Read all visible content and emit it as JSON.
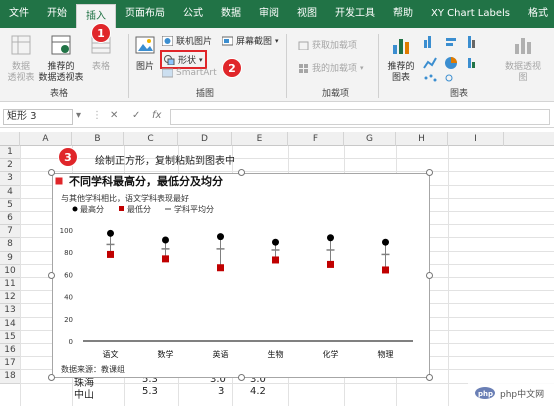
{
  "tabs": [
    "文件",
    "开始",
    "插入",
    "页面布局",
    "公式",
    "数据",
    "审阅",
    "视图",
    "开发工具",
    "帮助",
    "XY Chart Labels",
    "格式"
  ],
  "ribbon": {
    "tables_group": "表格",
    "pivot_label": "数据\n透视表",
    "rec_pivot_label": "推荐的\n数据透视表",
    "table_label": "表格",
    "illus_group": "插图",
    "picture_label": "图片",
    "online_picture": "联机图片",
    "shapes": "形状",
    "smartart": "SmartArt",
    "screenshot": "屏幕截图",
    "addins_group": "加载项",
    "get_addins": "获取加载项",
    "my_addins": "我的加载项",
    "charts_group": "图表",
    "rec_charts": "推荐的\n图表",
    "pivot_chart": "数据透视\n图"
  },
  "formula_bar": {
    "name_box": "矩形 3",
    "fx": "fx"
  },
  "columns": [
    "A",
    "B",
    "C",
    "D",
    "E",
    "F",
    "G",
    "H",
    "I"
  ],
  "rows": [
    "1",
    "2",
    "3",
    "4",
    "5",
    "6",
    "7",
    "8",
    "9",
    "10",
    "11",
    "12",
    "13",
    "14",
    "15",
    "16",
    "17",
    "18"
  ],
  "instruction": "绘制正方形，复制粘贴到图表中",
  "cells": {
    "r17": [
      "5.3",
      "3.0",
      "3.0"
    ],
    "r18_label": "中山",
    "r18": [
      "5.3",
      "3",
      "4.2"
    ],
    "r17_label": "珠海"
  },
  "badges": [
    "1",
    "2",
    "3"
  ],
  "chart": {
    "title": "不同学科最高分，最低分及均分",
    "subtitle": "与其他学科相比，语文学科表现最好",
    "source": "数据来源：教课组"
  },
  "chart_data": {
    "type": "scatter",
    "categories": [
      "语文",
      "数学",
      "英语",
      "生物",
      "化学",
      "物理"
    ],
    "series": [
      {
        "name": "最高分",
        "values": [
          97,
          91,
          94,
          89,
          93,
          89
        ],
        "color": "#000000",
        "marker": "circle"
      },
      {
        "name": "最低分",
        "values": [
          78,
          74,
          66,
          73,
          69,
          64
        ],
        "color": "#c00000",
        "marker": "square"
      },
      {
        "name": "学科平均分",
        "values": [
          87,
          83,
          83,
          82,
          82,
          78
        ],
        "color": "#808080",
        "marker": "dash"
      }
    ],
    "yticks": [
      0,
      20,
      40,
      60,
      80,
      100
    ],
    "ylim": [
      0,
      100
    ],
    "legend": "top-left",
    "grid": false
  },
  "watermark": "php中文网",
  "colors": {
    "accent": "#217346",
    "badge": "#e0262a",
    "highlight": "#e0262a"
  }
}
